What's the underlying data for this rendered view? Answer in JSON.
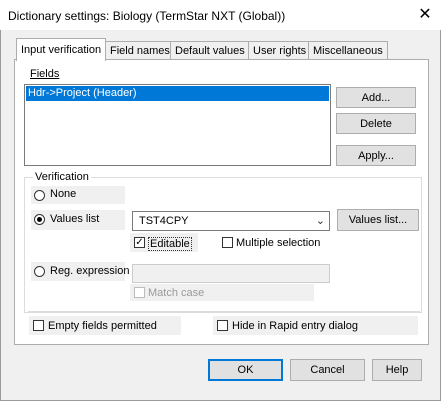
{
  "window": {
    "title": "Dictionary settings: Biology (TermStar NXT (Global))",
    "close_glyph": "✕"
  },
  "tabs": [
    {
      "label": "Input verification",
      "active": true
    },
    {
      "label": "Field names",
      "active": false
    },
    {
      "label": "Default values",
      "active": false
    },
    {
      "label": "User rights",
      "active": false
    },
    {
      "label": "Miscellaneous",
      "active": false
    }
  ],
  "fields": {
    "label": "Fields",
    "items": [
      {
        "label": "Hdr->Project (Header)",
        "selected": true
      }
    ]
  },
  "side_buttons": {
    "add": "Add...",
    "delete": "Delete",
    "apply": "Apply..."
  },
  "verification": {
    "label": "Verification",
    "none_label": "None",
    "values_list_label": "Values list",
    "values_list_value": "TST4CPY",
    "values_list_button": "Values list...",
    "editable_label": "Editable",
    "editable_checked": true,
    "multiple_selection_label": "Multiple selection",
    "multiple_selection_checked": false,
    "reg_expression_label": "Reg. expression",
    "reg_expression_value": "",
    "match_case_label": "Match case",
    "selected_option": "values_list"
  },
  "options": {
    "empty_fields_label": "Empty fields permitted",
    "hide_rapid_label": "Hide in Rapid entry dialog"
  },
  "footer": {
    "ok": "OK",
    "cancel": "Cancel",
    "help": "Help"
  },
  "icons": {
    "combo_arrow": "chevron-down-icon",
    "check": "checkmark-icon"
  }
}
